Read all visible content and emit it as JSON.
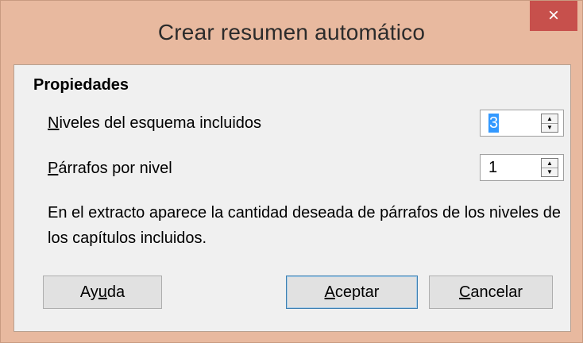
{
  "window": {
    "title": "Crear resumen automático",
    "close_glyph": "×"
  },
  "properties": {
    "heading": "Propiedades",
    "levels": {
      "label_mnemonic": "N",
      "label_rest": "iveles del esquema incluidos",
      "value": "3"
    },
    "paragraphs": {
      "label_mnemonic": "P",
      "label_rest": "árrafos por nivel",
      "value": "1"
    },
    "description": "En el extracto aparece la cantidad deseada de párrafos de los niveles de los capítulos incluidos."
  },
  "buttons": {
    "help": {
      "before": "Ay",
      "mnemonic": "u",
      "after": "da"
    },
    "ok": {
      "before": "",
      "mnemonic": "A",
      "after": "ceptar"
    },
    "cancel": {
      "before": "",
      "mnemonic": "C",
      "after": "ancelar"
    }
  },
  "icons": {
    "close": "close-icon",
    "spin_up": "arrow-up-icon",
    "spin_down": "arrow-down-icon"
  },
  "colors": {
    "titlebar": "#e8b99f",
    "close_button": "#c7504c",
    "selection": "#3399ff",
    "default_button_border": "#3c7fb1"
  }
}
